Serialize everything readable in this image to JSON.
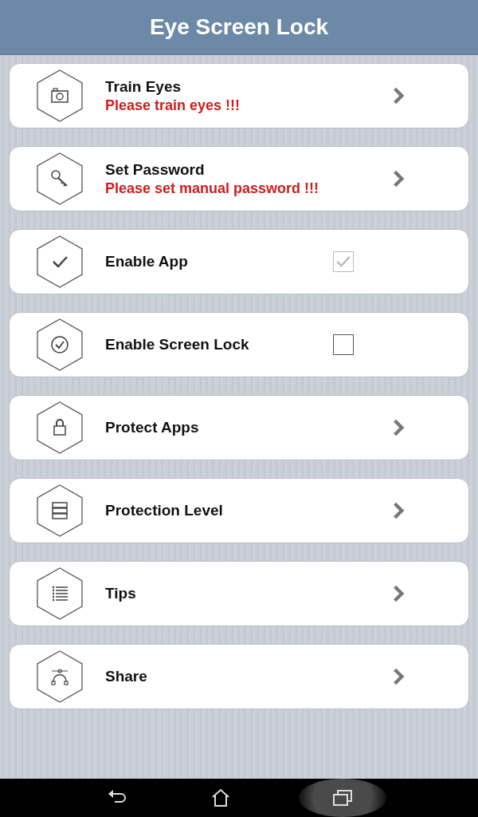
{
  "header": {
    "title": "Eye Screen Lock"
  },
  "items": [
    {
      "kind": "link",
      "label": "Train Eyes",
      "warning": "Please train eyes !!!"
    },
    {
      "kind": "link",
      "label": "Set Password",
      "warning": "Please set manual password !!!"
    },
    {
      "kind": "checkbox",
      "label": "Enable App",
      "checked": true,
      "disabled": true
    },
    {
      "kind": "checkbox",
      "label": "Enable Screen Lock",
      "checked": false,
      "disabled": false
    },
    {
      "kind": "link",
      "label": "Protect Apps"
    },
    {
      "kind": "link",
      "label": "Protection Level"
    },
    {
      "kind": "link",
      "label": "Tips"
    },
    {
      "kind": "link",
      "label": "Share"
    }
  ],
  "nav_bar": [
    {
      "kind": "back",
      "selected": false
    },
    {
      "kind": "home",
      "selected": false
    },
    {
      "kind": "recents",
      "selected": true
    }
  ]
}
